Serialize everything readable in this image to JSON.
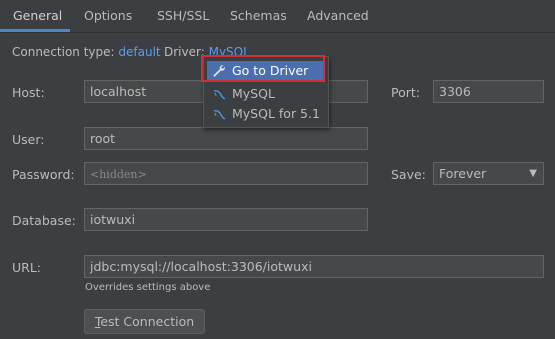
{
  "tabs": [
    "General",
    "Options",
    "SSH/SSL",
    "Schemas",
    "Advanced"
  ],
  "connection": {
    "type_label": "Connection type:",
    "type_value": "default",
    "driver_label": "Driver:",
    "driver_value": "MySQL"
  },
  "driver_menu": {
    "items": [
      "Go to Driver",
      "MySQL",
      "MySQL for 5.1"
    ],
    "selected": "Go to Driver"
  },
  "form": {
    "host_label": "Host:",
    "host_value": "localhost",
    "port_label": "Port:",
    "port_value": "3306",
    "user_label": "User:",
    "user_value": "root",
    "password_label": "Password:",
    "password_placeholder": "<hidden>",
    "save_label": "Save:",
    "save_value": "Forever",
    "database_label": "Database:",
    "database_value": "iotwuxi",
    "url_label": "URL:",
    "url_value": "jdbc:mysql://localhost:3306/iotwuxi",
    "url_note": "Overrides settings above"
  },
  "test_button": {
    "mnemonic": "T",
    "rest": "est Connection"
  },
  "colors": {
    "accent": "#589df6",
    "selection": "#4b6eaf",
    "highlight": "#d0303a"
  }
}
